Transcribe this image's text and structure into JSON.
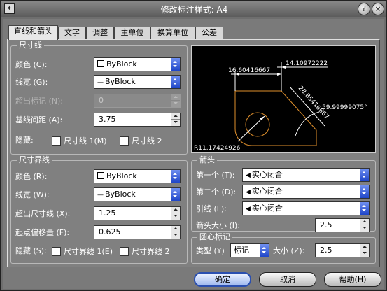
{
  "window": {
    "title": "修改标注样式: A4",
    "app_icon": "✦"
  },
  "tabs": [
    "直线和箭头",
    "文字",
    "调整",
    "主单位",
    "换算单位",
    "公差"
  ],
  "dim_lines": {
    "title": "尺寸线",
    "color_label": "颜色 (C):",
    "color_value": "ByBlock",
    "lineweight_label": "线宽 (G):",
    "lineweight_value": "ByBlock",
    "extend_label": "超出标记 (N):",
    "extend_value": "0",
    "baseline_label": "基线间距 (A):",
    "baseline_value": "3.75",
    "suppress_label": "隐藏:",
    "suppress_1": "尺寸线 1(M)",
    "suppress_2": "尺寸线 2"
  },
  "ext_lines": {
    "title": "尺寸界线",
    "color_label": "颜色 (R):",
    "color_value": "ByBlock",
    "lineweight_label": "线宽 (W):",
    "lineweight_value": "ByBlock",
    "extend_label": "超出尺寸线 (X):",
    "extend_value": "1.25",
    "offset_label": "起点偏移量 (F):",
    "offset_value": "0.625",
    "suppress_label": "隐藏 (S):",
    "suppress_1": "尺寸界线 1(E)",
    "suppress_2": "尺寸界线 2"
  },
  "preview": {
    "dim_top": "14.10972222",
    "dim_left": "16.60416667",
    "dim_diag": "28.85416667",
    "dim_angle": "59.99999075°",
    "dim_radius": "R11.17424926"
  },
  "arrows": {
    "title": "箭头",
    "first_label": "第一个 (T):",
    "first_value": "实心闭合",
    "second_label": "第二个 (D):",
    "second_value": "实心闭合",
    "leader_label": "引线 (L):",
    "leader_value": "实心闭合",
    "size_label": "箭头大小 (I):",
    "size_value": "2.5"
  },
  "center_marks": {
    "title": "圆心标记",
    "type_label": "类型 (Y)",
    "type_value": "标记",
    "size_label": "大小 (Z):",
    "size_value": "2.5"
  },
  "buttons": {
    "ok": "确定",
    "cancel": "取消",
    "help": "帮助(H)"
  },
  "colors": {
    "preview_geometry": "#e0902c",
    "preview_dims": "#ffffff",
    "accent": "#2a4fb0"
  }
}
